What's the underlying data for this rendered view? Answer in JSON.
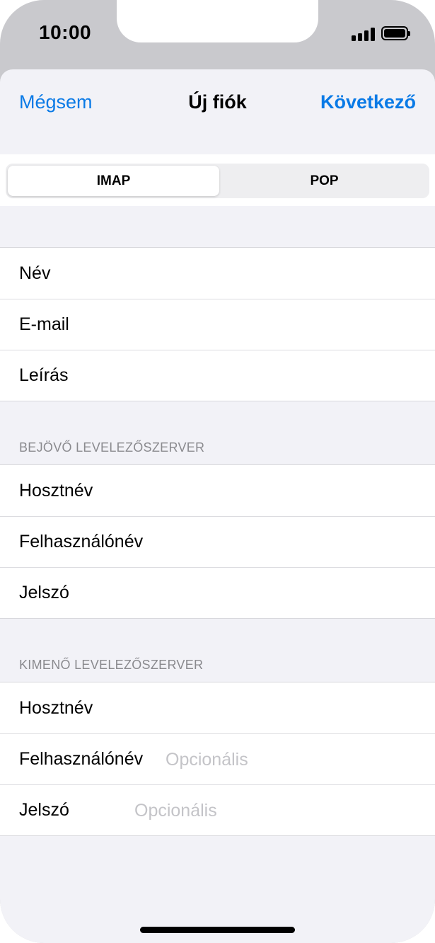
{
  "status_bar": {
    "time": "10:00"
  },
  "navbar": {
    "cancel_label": "Mégsem",
    "title": "Új fiók",
    "next_label": "Következő"
  },
  "segmented": {
    "options": [
      "IMAP",
      "POP"
    ],
    "selected": "IMAP"
  },
  "account": {
    "rows": [
      {
        "label": "Név",
        "value": "",
        "placeholder": ""
      },
      {
        "label": "E-mail",
        "value": "",
        "placeholder": ""
      },
      {
        "label": "Leírás",
        "value": "",
        "placeholder": ""
      }
    ]
  },
  "incoming": {
    "header": "BEJÖVŐ LEVELEZŐSZERVER",
    "rows": [
      {
        "label": "Hosztnév",
        "value": "",
        "placeholder": ""
      },
      {
        "label": "Felhasználónév",
        "value": "",
        "placeholder": ""
      },
      {
        "label": "Jelszó",
        "value": "",
        "placeholder": ""
      }
    ]
  },
  "outgoing": {
    "header": "KIMENŐ LEVELEZŐSZERVER",
    "rows": [
      {
        "label": "Hosztnév",
        "value": "",
        "placeholder": ""
      },
      {
        "label": "Felhasználónév",
        "value": "",
        "placeholder": "Opcionális"
      },
      {
        "label": "Jelszó",
        "value": "",
        "placeholder": "Opcionális"
      }
    ]
  },
  "colors": {
    "accent": "#0a7ae6",
    "grouped_background": "#f2f2f7",
    "placeholder": "#c4c4c8",
    "section_header": "#8a8a8e"
  }
}
